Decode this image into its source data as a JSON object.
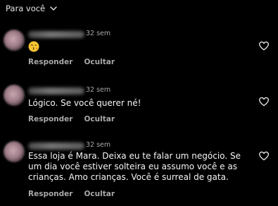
{
  "header": {
    "title": "Para você"
  },
  "comments": [
    {
      "time": "32 sem",
      "text": "",
      "emoji": "kissing-face-emoji",
      "reply_label": "Responder",
      "hide_label": "Ocultar"
    },
    {
      "time": "32 sem",
      "text": "Lógico. Se você querer né!",
      "reply_label": "Responder",
      "hide_label": "Ocultar"
    },
    {
      "time": "32 sem",
      "text": "Essa loja é Mara. Deixa eu te falar um negócio. Se um dia você estiver solteira eu assumo você e as crianças. Amo crianças. Você é surreal de gata.",
      "reply_label": "Responder",
      "hide_label": "Ocultar"
    }
  ],
  "colors": {
    "background": "#000000",
    "text": "#f5f5f5",
    "secondary": "#a8a8a8"
  }
}
